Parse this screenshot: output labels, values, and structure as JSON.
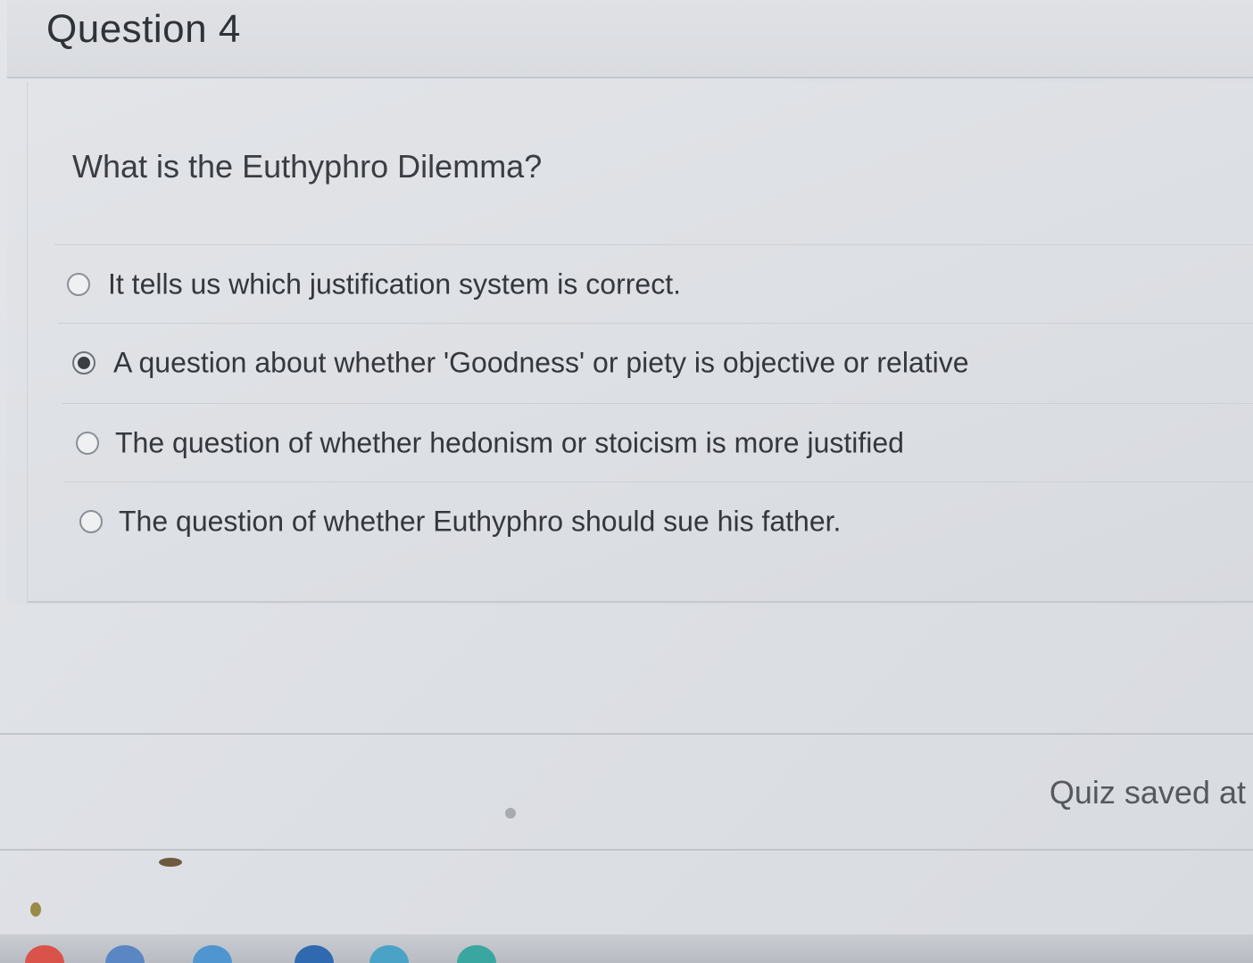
{
  "question": {
    "title": "Question 4",
    "prompt": "What is the Euthyphro Dilemma?",
    "options": [
      {
        "label": "It tells us which justification system is correct.",
        "selected": false
      },
      {
        "label": "A question about whether 'Goodness' or piety is objective or relative",
        "selected": true
      },
      {
        "label": "The question of whether hedonism or stoicism is more justified",
        "selected": false
      },
      {
        "label": "The question of whether Euthyphro should sue his father.",
        "selected": false
      }
    ]
  },
  "footer": {
    "status": "Quiz saved at"
  },
  "colors": {
    "background": "#dcdfe4",
    "text": "#34373c",
    "radio_border": "#8b9096",
    "radio_selected": "#3b3f45"
  }
}
